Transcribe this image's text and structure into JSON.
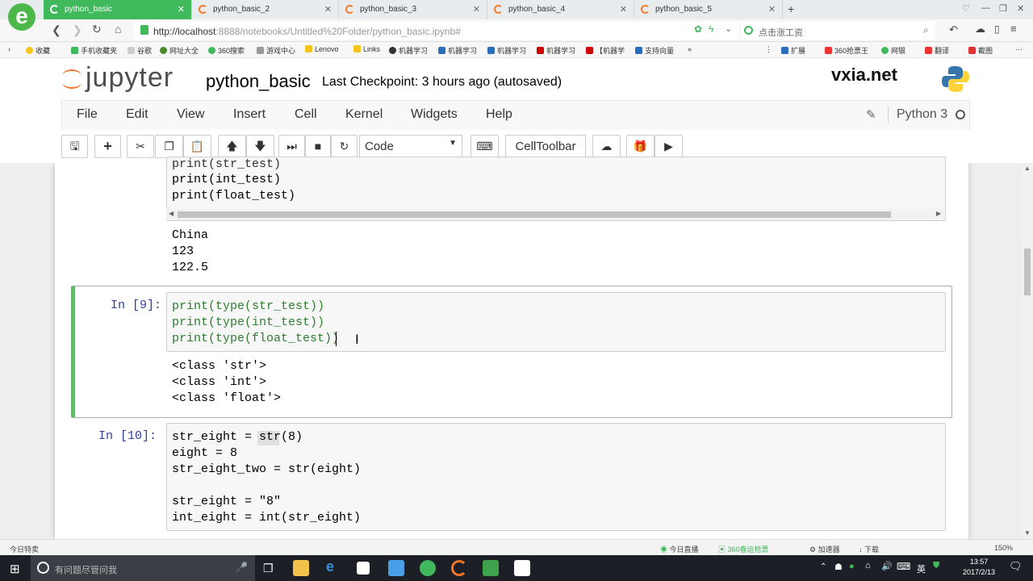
{
  "browser": {
    "tabs": [
      {
        "label": "python_basic",
        "active": true
      },
      {
        "label": "python_basic_2"
      },
      {
        "label": "python_basic_3"
      },
      {
        "label": "python_basic_4"
      },
      {
        "label": "python_basic_5"
      }
    ],
    "url_host": "http://localhost",
    "url_rest": ":8888/notebooks/Untitled%20Folder/python_basic.ipynb#",
    "search_placeholder": "点击涨工资",
    "bookmarks": [
      "收藏",
      "手机收藏夹",
      "谷歌",
      "网址大全",
      "360搜索",
      "游戏中心",
      "Lenovo",
      "Links",
      "机器学习",
      "机器学习",
      "机器学习",
      "机器学习",
      "【机器学",
      "支持向量"
    ],
    "bookmarks_right": [
      "扩展",
      "360抢票王",
      "网银",
      "翻译",
      "截图"
    ],
    "colors": {
      "tab_active": "#3fb95b",
      "cell_selected": "#66bb6a",
      "prompt": "#303f9f"
    }
  },
  "jupyter": {
    "logo": "jupyter",
    "notebook_title": "python_basic",
    "checkpoint": "Last Checkpoint: 3 hours ago (autosaved)",
    "watermark": "vxia.net",
    "menu": [
      "File",
      "Edit",
      "View",
      "Insert",
      "Cell",
      "Kernel",
      "Widgets",
      "Help"
    ],
    "kernel": "Python 3",
    "cell_type": "Code",
    "celltoolbar": "CellToolbar"
  },
  "cells": {
    "c8": {
      "lines": [
        "print(str_test)",
        "print(int_test)",
        "print(float_test)"
      ],
      "output": [
        "China",
        "123",
        "122.5"
      ]
    },
    "c9": {
      "prompt": "In [9]:",
      "lines": [
        "print(type(str_test))",
        "print(type(int_test))",
        "print(type(float_test))"
      ],
      "output": [
        "<class 'str'>",
        "<class 'int'>",
        "<class 'float'>"
      ]
    },
    "c10": {
      "prompt": "In [10]:",
      "lines": [
        "str_eight = str(8)",
        "eight = 8",
        "str_eight_two = str(eight)",
        "",
        "str_eight = \"8\"",
        "int_eight = int(str_eight)"
      ]
    }
  },
  "statusbar": {
    "left": "今日特卖",
    "items": [
      "今日直播",
      "360春运抢票",
      "加速器",
      "下载"
    ],
    "zoom": "150%"
  },
  "taskbar": {
    "search_placeholder": "有问题尽管问我",
    "time": "13:57",
    "date": "2017/2/13",
    "ime": "英"
  }
}
